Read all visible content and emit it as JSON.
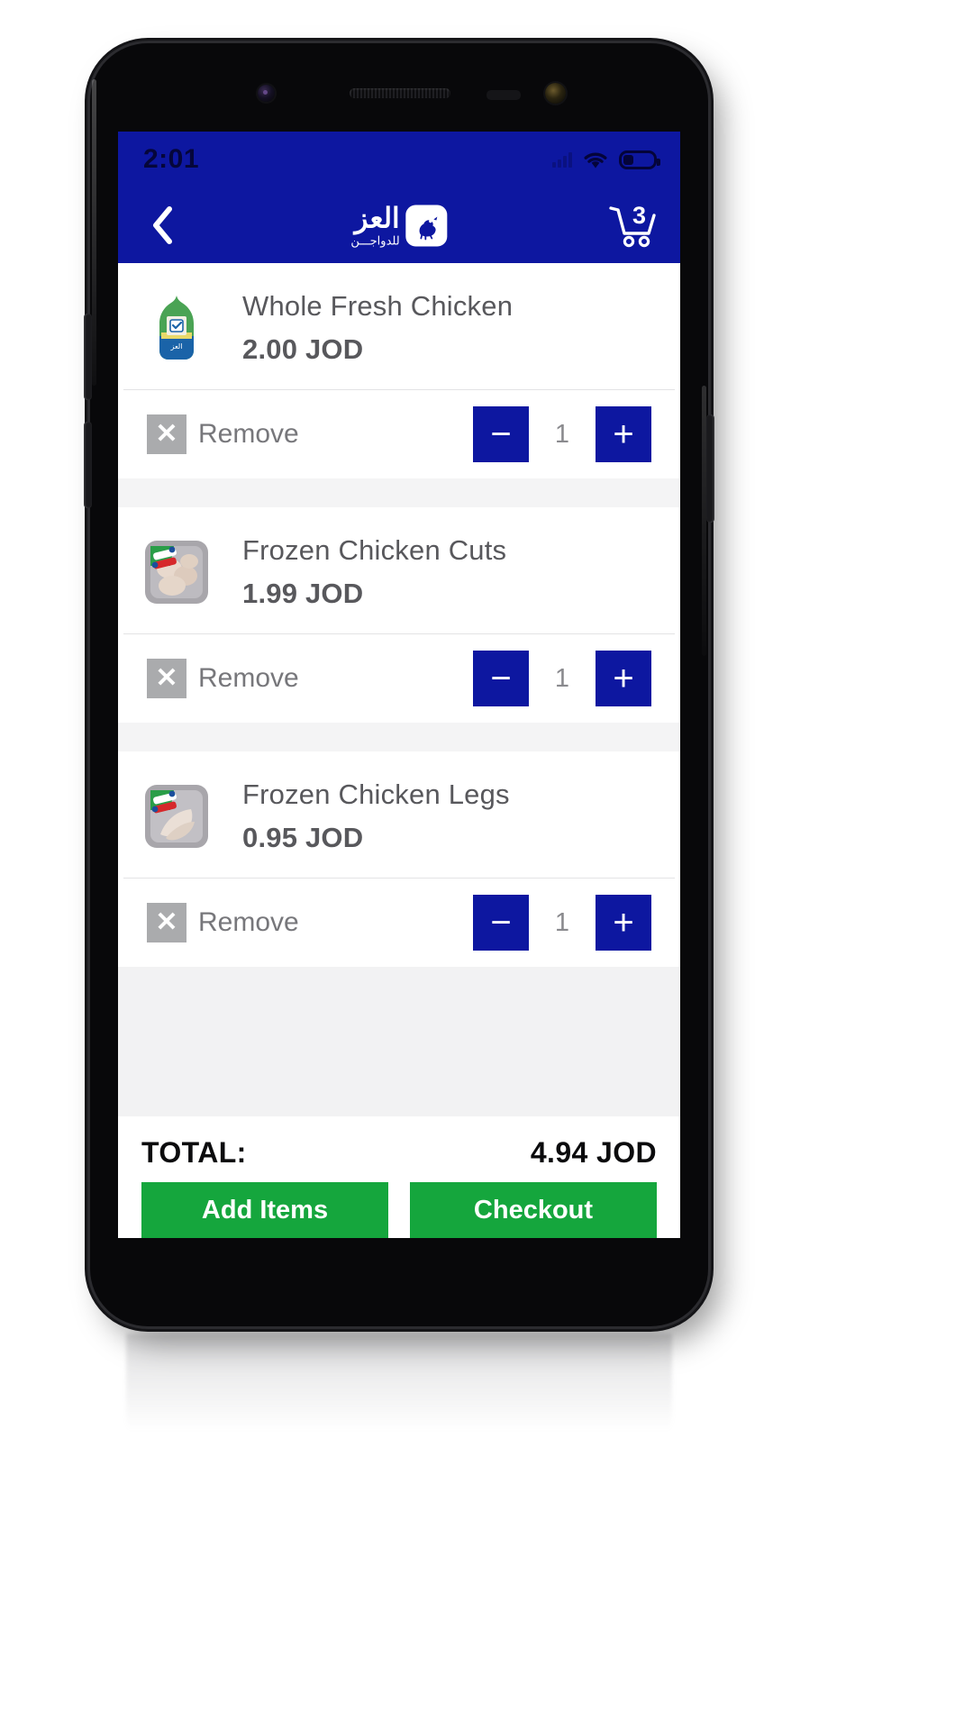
{
  "status_bar": {
    "time": "2:01",
    "icons": [
      "signal-icon",
      "wifi-icon",
      "battery-icon"
    ],
    "battery_level_pct": 28
  },
  "app_bar": {
    "back_icon": "chevron-left-icon",
    "brand_name_ar": "العز",
    "brand_tagline_ar": "للدواجـــن",
    "brand_mark_icon": "chicken-logo-icon",
    "cart_icon": "shopping-cart-icon",
    "cart_count": "3"
  },
  "cart": {
    "items": [
      {
        "name": "Whole Fresh Chicken",
        "price": "2.00 JOD",
        "quantity": "1",
        "remove_label": "Remove",
        "thumb": "whole-fresh-chicken-pack",
        "decrement_label": "−",
        "increment_label": "+"
      },
      {
        "name": "Frozen Chicken Cuts",
        "price": "1.99 JOD",
        "quantity": "1",
        "remove_label": "Remove",
        "thumb": "frozen-chicken-cuts-tray",
        "decrement_label": "−",
        "increment_label": "+"
      },
      {
        "name": "Frozen Chicken Legs",
        "price": "0.95 JOD",
        "quantity": "1",
        "remove_label": "Remove",
        "thumb": "frozen-chicken-legs-tray",
        "decrement_label": "−",
        "increment_label": "+"
      }
    ]
  },
  "footer": {
    "total_label": "TOTAL:",
    "total_value": "4.94 JOD",
    "add_items_label": "Add Items",
    "checkout_label": "Checkout"
  },
  "colors": {
    "brand_blue": "#0d17a0",
    "action_green": "#15a63d",
    "remove_gray": "#aaabad",
    "text_gray": "#58585c"
  }
}
